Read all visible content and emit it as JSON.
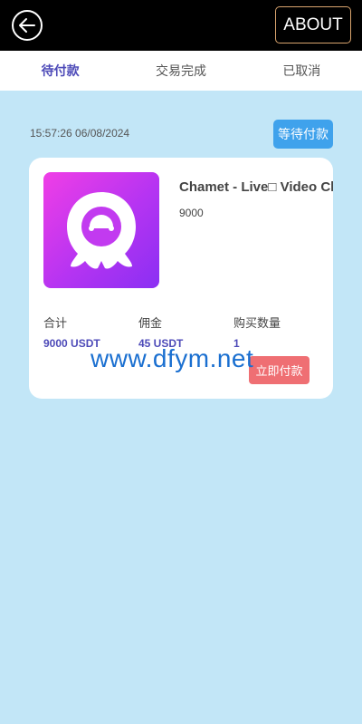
{
  "header": {
    "about_label": "ABOUT",
    "back_icon": "arrow-left-circle-icon"
  },
  "tabs": [
    {
      "label": "待付款",
      "active": true
    },
    {
      "label": "交易完成",
      "active": false
    },
    {
      "label": "已取消",
      "active": false
    }
  ],
  "order": {
    "timestamp": "15:57:26 06/08/2024",
    "status": "等待付款",
    "product_name": "Chamet - Live□ Video Cl",
    "product_price": "9000",
    "total_label": "合计",
    "total_value": "9000 USDT",
    "commission_label": "佣金",
    "commission_value": "45 USDT",
    "quantity_label": "购买数量",
    "quantity_value": "1",
    "pay_button": "立即付款"
  },
  "watermark": "www.dfym.net",
  "colors": {
    "topbar": "#000000",
    "background": "#c2e6f7",
    "active_tab": "#4d4ab8",
    "status_button": "#3fa2ec",
    "pay_button": "#ef6f73"
  }
}
